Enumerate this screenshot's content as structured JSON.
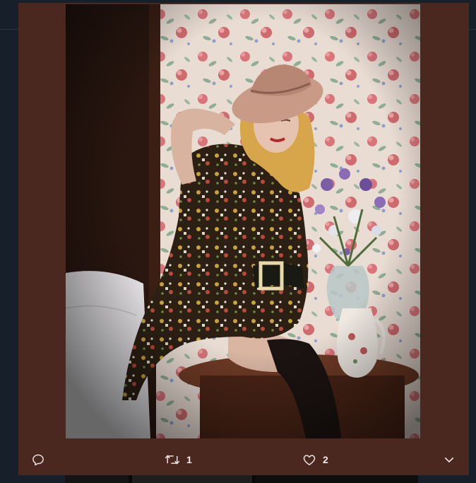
{
  "colors": {
    "modal_background": "#4a281f",
    "icon_color": "#e8e1de",
    "page_background": "#17202a"
  },
  "media": {
    "photo_icon": "photo-image"
  },
  "actions": {
    "reply": {
      "icon": "reply-icon"
    },
    "retweet": {
      "icon": "retweet-icon",
      "count": "1"
    },
    "like": {
      "icon": "heart-icon",
      "count": "2"
    },
    "more": {
      "icon": "chevron-down-icon"
    }
  }
}
